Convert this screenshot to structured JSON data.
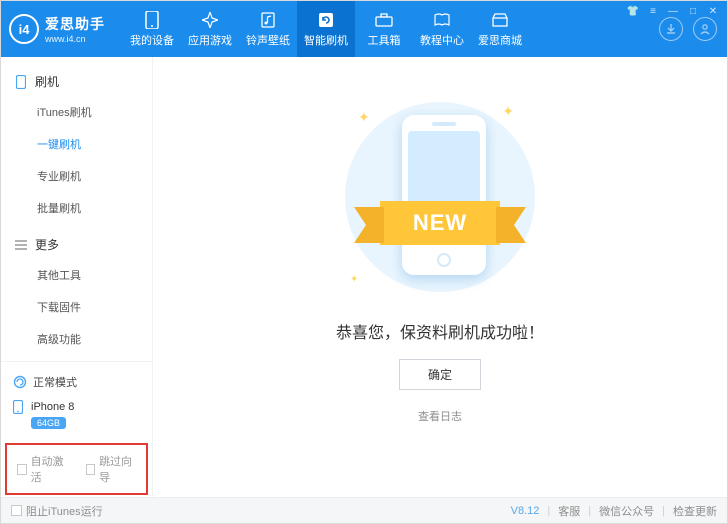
{
  "app": {
    "name": "爱思助手",
    "site": "www.i4.cn",
    "logo_mark": "i4"
  },
  "nav": [
    {
      "label": "我的设备",
      "icon": "phone"
    },
    {
      "label": "应用游戏",
      "icon": "apps"
    },
    {
      "label": "铃声壁纸",
      "icon": "music"
    },
    {
      "label": "智能刷机",
      "icon": "refresh",
      "active": true
    },
    {
      "label": "工具箱",
      "icon": "toolbox"
    },
    {
      "label": "教程中心",
      "icon": "book"
    },
    {
      "label": "爱思商城",
      "icon": "shop"
    }
  ],
  "sidebar": {
    "sections": [
      {
        "title": "刷机",
        "icon": "phone-outline",
        "items": [
          {
            "label": "iTunes刷机"
          },
          {
            "label": "一键刷机",
            "active": true
          },
          {
            "label": "专业刷机"
          },
          {
            "label": "批量刷机"
          }
        ]
      },
      {
        "title": "更多",
        "icon": "list",
        "items": [
          {
            "label": "其他工具"
          },
          {
            "label": "下载固件"
          },
          {
            "label": "高级功能"
          }
        ]
      }
    ]
  },
  "device": {
    "mode": "正常模式",
    "model": "iPhone 8",
    "storage": "64GB"
  },
  "options": {
    "auto_activate": "自动激活",
    "skip_guide": "跳过向导"
  },
  "main": {
    "new_label": "NEW",
    "success_title": "恭喜您，保资料刷机成功啦！",
    "confirm": "确定",
    "view_log": "查看日志"
  },
  "bottom": {
    "block_itunes": "阻止iTunes运行",
    "version": "V8.12",
    "support": "客服",
    "wechat": "微信公众号",
    "check_update": "检查更新"
  }
}
